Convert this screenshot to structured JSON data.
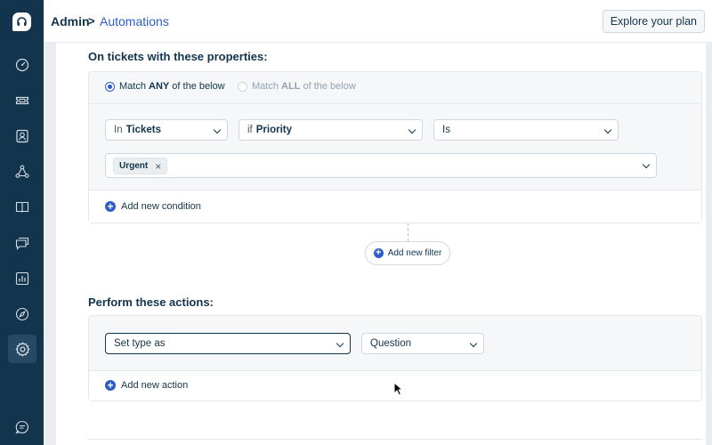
{
  "header": {
    "breadcrumb_root": "Admin",
    "breadcrumb_separator": ">",
    "breadcrumb_current": "Automations",
    "explore_button": "Explore your plan"
  },
  "sidebar": {
    "items": [
      {
        "icon": "dashboard-icon"
      },
      {
        "icon": "ticket-icon"
      },
      {
        "icon": "contacts-icon"
      },
      {
        "icon": "social-icon"
      },
      {
        "icon": "knowledge-base-icon"
      },
      {
        "icon": "chat-icon"
      },
      {
        "icon": "reports-icon"
      },
      {
        "icon": "explore-icon"
      },
      {
        "icon": "settings-icon",
        "active": true
      },
      {
        "icon": "help-icon"
      }
    ]
  },
  "conditions": {
    "title": "On tickets with these properties:",
    "match_any_prefix": "Match ",
    "match_any_bold": "ANY",
    "match_any_suffix": " of the below",
    "match_all_prefix": "Match ",
    "match_all_bold": "ALL",
    "match_all_suffix": " of the below",
    "selected_match": "any",
    "in_prefix": "In",
    "in_value": "Tickets",
    "if_prefix": "if",
    "if_value": "Priority",
    "operator_value": "Is",
    "tag_value": "Urgent",
    "tag_remove": "×",
    "add_condition": "Add new condition"
  },
  "filter": {
    "add_filter": "Add new filter"
  },
  "actions": {
    "title": "Perform these actions:",
    "action_value": "Set type as",
    "type_value": "Question",
    "add_action": "Add new action"
  },
  "colors": {
    "sidebar_bg": "#12344d",
    "accent": "#2c5cc5",
    "text": "#12344d"
  }
}
